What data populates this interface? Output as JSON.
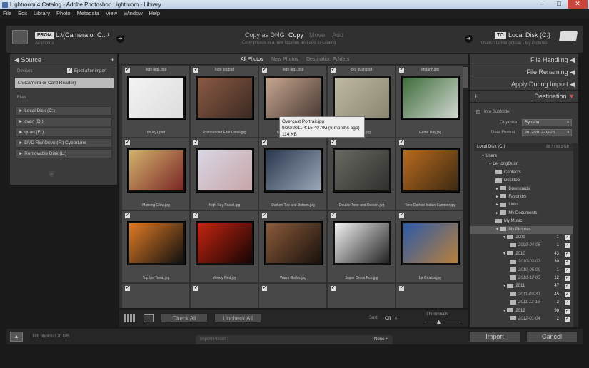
{
  "window": {
    "title": "Lightroom 4 Catalog - Adobe Photoshop Lightroom - Library",
    "minimize": "–",
    "maximize": "□",
    "close": "✕"
  },
  "menu": [
    "File",
    "Edit",
    "Library",
    "Photo",
    "Metadata",
    "View",
    "Window",
    "Help"
  ],
  "header": {
    "from_badge": "FROM",
    "from_path": "L:\\(Camera or C...",
    "from_sub": "All photos",
    "mode_dng": "Copy as DNG",
    "mode_copy": "Copy",
    "mode_move": "Move",
    "mode_add": "Add",
    "mode_desc": "Copy photos to a new location and add to catalog",
    "to_badge": "TO",
    "to_path": "Local Disk (C:)",
    "to_sub": "Users \\ LeHongQuan \\ My Pictures"
  },
  "source": {
    "title": "Source",
    "devices_label": "Devices",
    "eject_label": "Eject after import",
    "device": "L:\\(Camera or Card Reader)",
    "files_label": "Files",
    "drives": [
      "Local Disk (C:)",
      "cvan (D:)",
      "quan (E:)",
      "DVD RW Drive (F:) CyberLink",
      "Removable Disk (L:)"
    ]
  },
  "tabs": [
    "All Photos",
    "New Photos",
    "Destination Folders"
  ],
  "grid": [
    {
      "top": "logo leq1.psd",
      "bottom": "chuky1.psd",
      "c1": "#f4f4f4",
      "c2": "#dcdcdc"
    },
    {
      "top": "logo leq.psd",
      "bottom": "Pronounced Fine Detail.jpg",
      "c1": "#8a5a44",
      "c2": "#3c2a22"
    },
    {
      "top": "logo leq1.psd",
      "bottom": "Overcast Portrait.jpg",
      "c1": "#c6a690",
      "c2": "#4a3a34"
    },
    {
      "top": "cky quan.psd",
      "bottom": "Big Sky.jpg",
      "c1": "#bfb9a4",
      "c2": "#8b866f"
    },
    {
      "top": "imdanh.jpg",
      "bottom": "Game Day.jpg",
      "c1": "#3f6d3b",
      "c2": "#cfd6cf"
    },
    {
      "top": "",
      "bottom": "Morning Glow.jpg",
      "c1": "#d1b26c",
      "c2": "#7c2626"
    },
    {
      "top": "",
      "bottom": "High Key Pastel.jpg",
      "c1": "#d9d6e4",
      "c2": "#c7a6a8"
    },
    {
      "top": "",
      "bottom": "Darken Top and Bottom.jpg",
      "c1": "#2a3850",
      "c2": "#9aa7b8"
    },
    {
      "top": "",
      "bottom": "Double Tone and Darken.jpg",
      "c1": "#6a6a64",
      "c2": "#2f2f2c"
    },
    {
      "top": "",
      "bottom": "Tone Darken Indian Summer.jpg",
      "c1": "#b86a1e",
      "c2": "#3c2a12"
    },
    {
      "top": "",
      "bottom": "Top the Tonal.jpg",
      "c1": "#e07a24",
      "c2": "#101010"
    },
    {
      "top": "",
      "bottom": "Moody Red.jpg",
      "c1": "#c42410",
      "c2": "#150505"
    },
    {
      "top": "",
      "bottom": "Warm Gothic.jpg",
      "c1": "#8a5a3a",
      "c2": "#1a120c"
    },
    {
      "top": "",
      "bottom": "Super Cross Pop.jpg",
      "c1": "#f2f2f2",
      "c2": "#222222"
    },
    {
      "top": "",
      "bottom": "La Giralda.jpg",
      "c1": "#2c5aa8",
      "c2": "#b8803a"
    }
  ],
  "tooltip": {
    "name": "Overcast Portrait.jpg",
    "date": "9/30/2011 4:15:40 AM (6 months ago)",
    "size": "114 KB"
  },
  "toolbar": {
    "check_all": "Check All",
    "uncheck_all": "Uncheck All",
    "sort_label": "Sort:",
    "sort_value": "Off",
    "thumbs_label": "Thumbnails"
  },
  "right": {
    "file_handling": "File Handling",
    "file_renaming": "File Renaming",
    "apply": "Apply During Import",
    "destination": "Destination",
    "into_sub": "Into Subfolder",
    "organize_label": "Organize",
    "organize_value": "By date",
    "format_label": "Date Format",
    "format_value": "2012/2012-03-28",
    "disk": "Local Disk (C:)",
    "disk_size": "28.7 / 58.5 GB"
  },
  "tree": [
    {
      "label": "Users",
      "indent": 0,
      "arrow": "▼",
      "folder": false
    },
    {
      "label": "LeHongQuan",
      "indent": 1,
      "arrow": "▼",
      "folder": false
    },
    {
      "label": "Contacts",
      "indent": 2,
      "arrow": "",
      "folder": true
    },
    {
      "label": "Desktop",
      "indent": 2,
      "arrow": "",
      "folder": true
    },
    {
      "label": "Downloads",
      "indent": 2,
      "arrow": "►",
      "folder": true
    },
    {
      "label": "Favorites",
      "indent": 2,
      "arrow": "►",
      "folder": true
    },
    {
      "label": "Links",
      "indent": 2,
      "arrow": "►",
      "folder": true
    },
    {
      "label": "My Documents",
      "indent": 2,
      "arrow": "►",
      "folder": true
    },
    {
      "label": "My Music",
      "indent": 2,
      "arrow": "",
      "folder": true
    },
    {
      "label": "My Pictures",
      "indent": 2,
      "arrow": "▼",
      "folder": true,
      "sel": true
    },
    {
      "label": "2009",
      "indent": 3,
      "arrow": "▼",
      "folder": true,
      "count": "1"
    },
    {
      "label": "2009-04-05",
      "indent": 4,
      "arrow": "",
      "folder": true,
      "count": "1"
    },
    {
      "label": "2010",
      "indent": 3,
      "arrow": "▼",
      "folder": true,
      "count": "43"
    },
    {
      "label": "2010-02-07",
      "indent": 4,
      "arrow": "",
      "folder": true,
      "count": "30"
    },
    {
      "label": "2010-05-09",
      "indent": 4,
      "arrow": "",
      "folder": true,
      "count": "1"
    },
    {
      "label": "2010-12-05",
      "indent": 4,
      "arrow": "",
      "folder": true,
      "count": "12"
    },
    {
      "label": "2011",
      "indent": 3,
      "arrow": "▼",
      "folder": true,
      "count": "47"
    },
    {
      "label": "2011-09-30",
      "indent": 4,
      "arrow": "",
      "folder": true,
      "count": "45"
    },
    {
      "label": "2011-12-15",
      "indent": 4,
      "arrow": "",
      "folder": true,
      "count": "2"
    },
    {
      "label": "2012",
      "indent": 3,
      "arrow": "▼",
      "folder": true,
      "count": "98"
    },
    {
      "label": "2012-01-04",
      "indent": 4,
      "arrow": "",
      "folder": true,
      "count": "2"
    }
  ],
  "footer": {
    "count": "189 photos / 70 MB",
    "preset_label": "Import Preset :",
    "preset_value": "None ÷",
    "import": "Import",
    "cancel": "Cancel"
  }
}
